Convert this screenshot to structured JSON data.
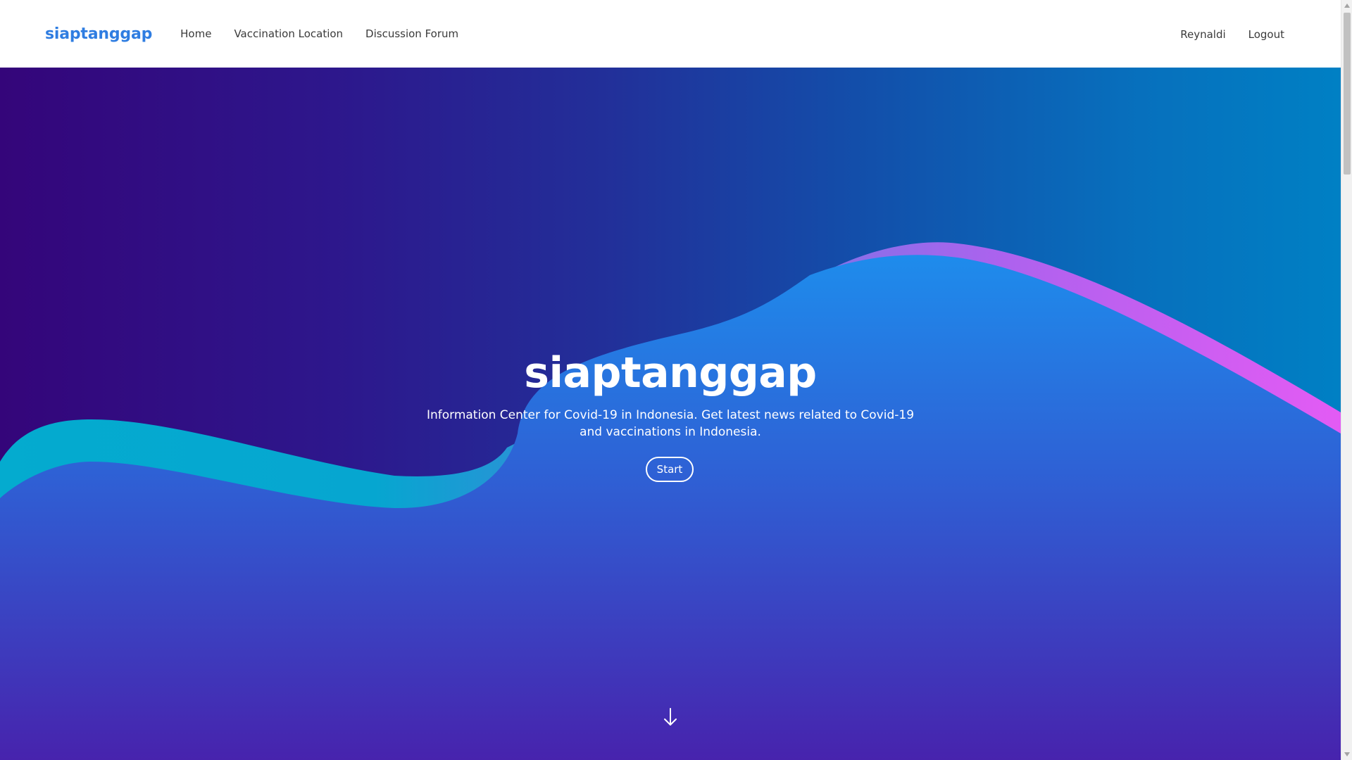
{
  "navbar": {
    "brand": "siaptanggap",
    "links": [
      {
        "label": "Home"
      },
      {
        "label": "Vaccination Location"
      },
      {
        "label": "Discussion Forum"
      }
    ],
    "user_name": "Reynaldi",
    "logout_label": "Logout"
  },
  "hero": {
    "title": "siaptanggap",
    "subtitle": "Information Center for Covid-19 in Indonesia. Get latest news related to Covid-19 and vaccinations in Indonesia.",
    "start_label": "Start",
    "scroll_icon": "arrow-down-icon"
  },
  "colors": {
    "brand": "#2f7de1",
    "hero_left": "#34057a",
    "hero_right": "#0080c4",
    "wave_blue_top": "#1e8cec",
    "wave_blue_bottom": "#4723ad",
    "wave_cyan": "#05a8cf",
    "wave_magenta": "#dd5cf2"
  }
}
